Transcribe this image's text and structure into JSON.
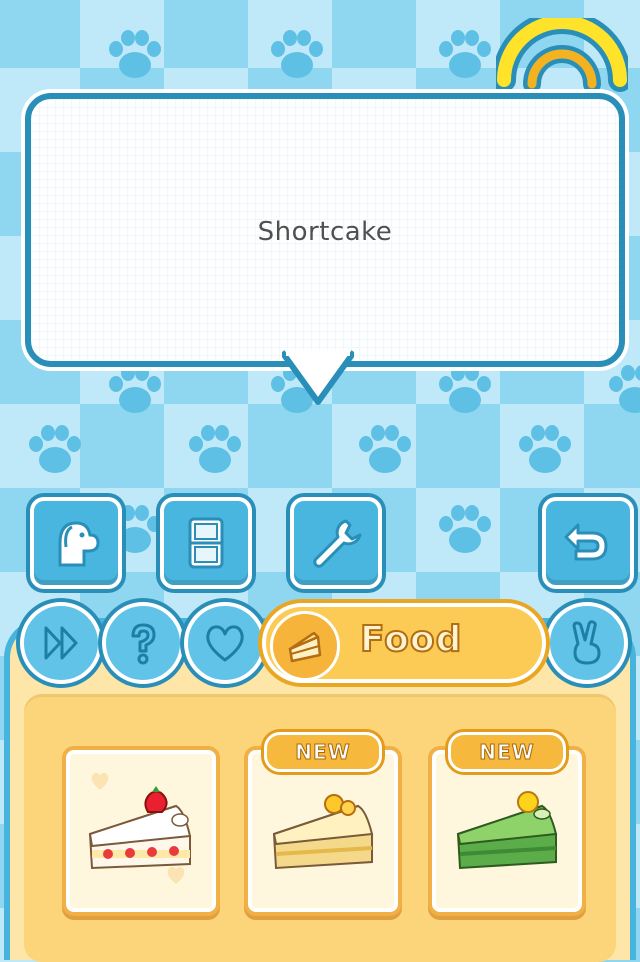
{
  "bubble": {
    "text": "Shortcake"
  },
  "toolbar": {
    "buttons": [
      {
        "icon": "dog-icon"
      },
      {
        "icon": "handheld-console-icon"
      },
      {
        "icon": "wrench-icon"
      },
      {
        "icon": "back-arrow-icon"
      }
    ]
  },
  "tabs": {
    "icons": [
      "skip-icon",
      "question-icon",
      "heart-icon",
      "peace-hand-icon"
    ],
    "active": {
      "label": "Food",
      "icon": "cake-slice-icon"
    }
  },
  "items": [
    {
      "name": "Shortcake",
      "badge": ""
    },
    {
      "name": "Orange cake",
      "badge": "NEW"
    },
    {
      "name": "Green tea cake",
      "badge": "NEW"
    }
  ],
  "colors": {
    "sky_light": "#bfe9f8",
    "sky": "#8fd6f0",
    "blue_outline": "#2a8fb8",
    "orange": "#fccb55",
    "panel": "#fde6a8"
  }
}
